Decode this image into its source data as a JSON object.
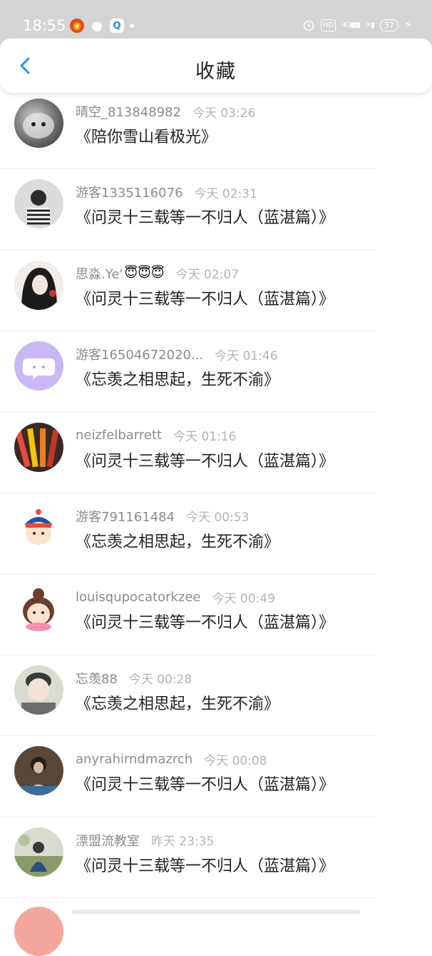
{
  "status_bar": {
    "time": "18:55",
    "apps": [
      "weibo-icon",
      "wechat-icon",
      "browser-icon"
    ],
    "hd": "HD",
    "signal": "4G",
    "battery": "37"
  },
  "header": {
    "title": "收藏",
    "back_icon": "chevron-left-icon",
    "accent_color": "#2196f3"
  },
  "favorites": [
    {
      "username": "晴空_813848982",
      "emoji": "",
      "time": "今天 03:26",
      "book": "《陪你雪山看极光》"
    },
    {
      "username": "游客1335116076",
      "emoji": "",
      "time": "今天 02:31",
      "book": "《问灵十三载等一不归人（蓝湛篇）》"
    },
    {
      "username": "思淼.Ye'",
      "emoji": "😇😇😇",
      "time": "今天 02:07",
      "book": "《问灵十三载等一不归人（蓝湛篇）》"
    },
    {
      "username": "游客16504672020...",
      "emoji": "",
      "time": "今天 01:46",
      "book": "《忘羡之相思起，生死不渝》"
    },
    {
      "username": "neizfelbarrett",
      "emoji": "",
      "time": "今天 01:16",
      "book": "《问灵十三载等一不归人（蓝湛篇）》"
    },
    {
      "username": "游客791161484",
      "emoji": "",
      "time": "今天 00:53",
      "book": "《忘羡之相思起，生死不渝》"
    },
    {
      "username": "louisqupocatorkzee",
      "emoji": "",
      "time": "今天 00:49",
      "book": "《问灵十三载等一不归人（蓝湛篇）》"
    },
    {
      "username": "忘羡88",
      "emoji": "",
      "time": "今天 00:28",
      "book": "《忘羡之相思起，生死不渝》"
    },
    {
      "username": "anyrahirndmazrch",
      "emoji": "",
      "time": "今天 00:08",
      "book": "《问灵十三载等一不归人（蓝湛篇）》"
    },
    {
      "username": "漂盟流教室",
      "emoji": "",
      "time": "昨天 23:35",
      "book": "《问灵十三载等一不归人（蓝湛篇）》"
    }
  ]
}
